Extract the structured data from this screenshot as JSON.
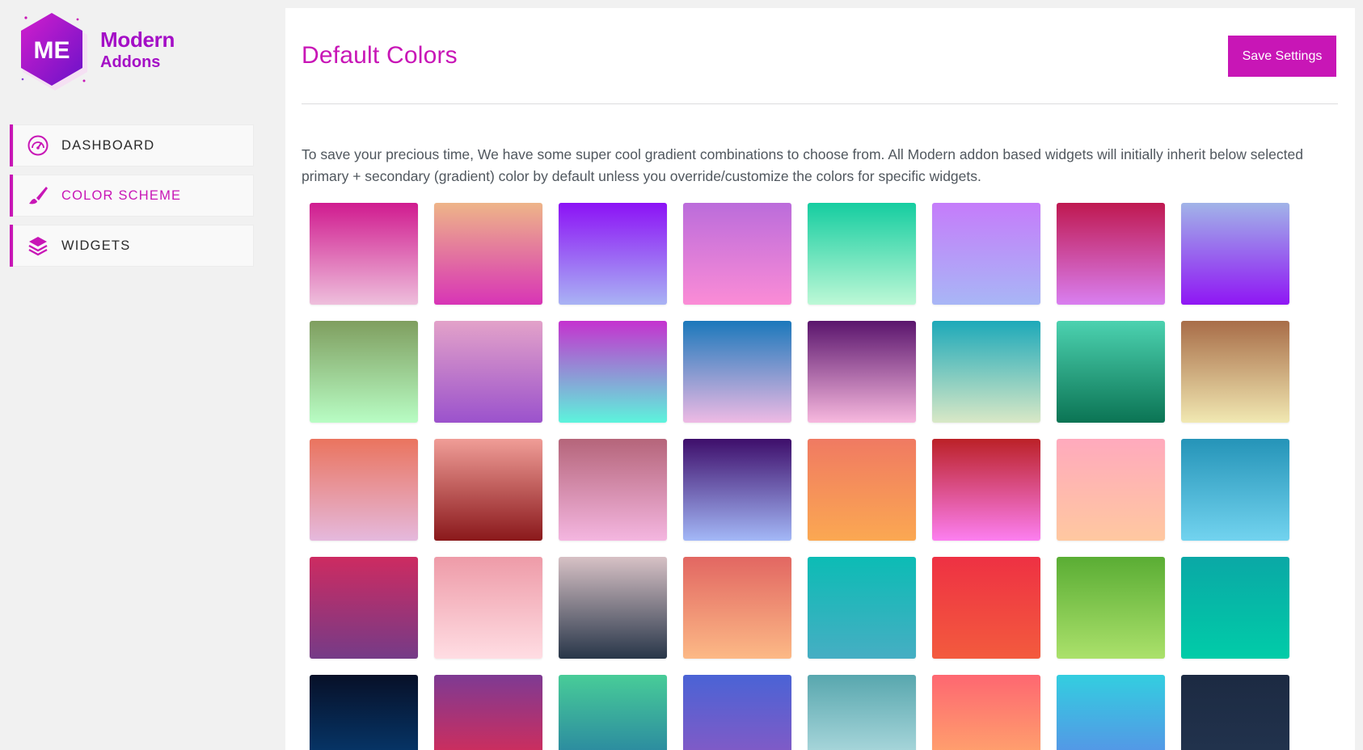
{
  "logo": {
    "mark": "ME",
    "line1": "Modern",
    "line2": "Addons"
  },
  "nav": [
    {
      "label": "DASHBOARD",
      "icon": "gauge-icon",
      "active": false
    },
    {
      "label": "COLOR SCHEME",
      "icon": "paint-brush-icon",
      "active": true
    },
    {
      "label": "WIDGETS",
      "icon": "layers-icon",
      "active": false
    }
  ],
  "header": {
    "title": "Default Colors",
    "save_label": "Save Settings"
  },
  "description": "To save your precious time, We have some super cool gradient combinations to choose from. All Modern addon based widgets will initially inherit below selected primary + secondary (gradient) color by default unless you override/customize the colors for specific widgets.",
  "colors": {
    "accent": "#c816b6",
    "brand_purple": "#a40ec6"
  },
  "swatches": [
    [
      "#d01b8f",
      "#eebfdc"
    ],
    [
      "#eeb588",
      "#d834b6"
    ],
    [
      "#8c12f5",
      "#a9b3f4"
    ],
    [
      "#bb6cdb",
      "#fb8cd6"
    ],
    [
      "#15cda0",
      "#bdf8d6"
    ],
    [
      "#c57cfa",
      "#a8b6f6"
    ],
    [
      "#bf1850",
      "#d97ff0"
    ],
    [
      "#a1b4e8",
      "#8f16f4"
    ],
    [
      "#7f9e5f",
      "#b8fdc4"
    ],
    [
      "#e3a2c9",
      "#9b52cc"
    ],
    [
      "#c532cf",
      "#5cf4dc"
    ],
    [
      "#1b78bb",
      "#eebae4"
    ],
    [
      "#5a156d",
      "#f7b8de"
    ],
    [
      "#1da9b9",
      "#d9e8c6"
    ],
    [
      "#4cd2b0",
      "#0b7454"
    ],
    [
      "#a86d48",
      "#f1e8b2"
    ],
    [
      "#ea745e",
      "#e5b9dd"
    ],
    [
      "#f09d97",
      "#8a181b"
    ],
    [
      "#b5657a",
      "#f4b6e0"
    ],
    [
      "#3e0e6b",
      "#a3b8f7"
    ],
    [
      "#f07a62",
      "#fba852"
    ],
    [
      "#bb2127",
      "#fc7ff0"
    ],
    [
      "#ffaabd",
      "#ffc8a0"
    ],
    [
      "#2594b8",
      "#72d3ef"
    ],
    [
      "#cd2b61",
      "#753b87"
    ],
    [
      "#ee9ba8",
      "#ffdde3"
    ],
    [
      "#d7c1c5",
      "#283649"
    ],
    [
      "#e26762",
      "#fcb986"
    ],
    [
      "#0cbcb5",
      "#46aec3"
    ],
    [
      "#ee3143",
      "#f35b3e"
    ],
    [
      "#5aad34",
      "#abe16b"
    ],
    [
      "#0aa8a6",
      "#01cca8"
    ],
    [
      "#071028",
      "#06407a"
    ],
    [
      "#7e3a93",
      "#e52a4d"
    ],
    [
      "#48cc98",
      "#2377a2"
    ],
    [
      "#4a63d5",
      "#9158c2"
    ],
    [
      "#58a7ae",
      "#c0e4e8"
    ],
    [
      "#fe6771",
      "#ffb16c"
    ],
    [
      "#33cee0",
      "#5e86e8"
    ],
    [
      "#1c2a42",
      "#233550"
    ]
  ]
}
